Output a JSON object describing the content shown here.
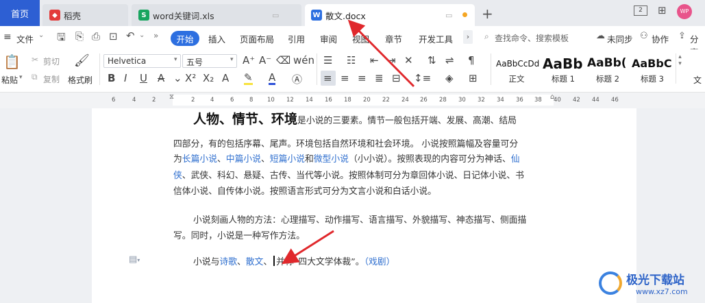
{
  "tabs": {
    "home": "首页",
    "daoke": "稻壳",
    "xls": "word关键词.xls",
    "docx": "散文.docx",
    "add": "+"
  },
  "window": {
    "avatar": "WP"
  },
  "menu": {
    "file": "文件",
    "start": "开始",
    "items": [
      "插入",
      "页面布局",
      "引用",
      "审阅",
      "视图",
      "章节",
      "开发工具"
    ],
    "search_placeholder": "查找命令、搜索模板",
    "unsync": "未同步",
    "collab": "协作",
    "share": "分享"
  },
  "toolbar": {
    "paste": "粘贴",
    "cut": "剪切",
    "copy": "复制",
    "format_painter": "格式刷",
    "font_name": "Helvetica",
    "font_size": "五号",
    "styles": [
      {
        "sample": "AaBbCcDd",
        "name": "正文"
      },
      {
        "sample": "AaBb",
        "name": "标题 1"
      },
      {
        "sample": "AaBb(",
        "name": "标题 2"
      },
      {
        "sample": "AaBbC",
        "name": "标题 3"
      }
    ],
    "more_label": "文"
  },
  "ruler": {
    "ticks": [
      "6",
      "4",
      "2",
      "2",
      "4",
      "6",
      "8",
      "10",
      "12",
      "14",
      "16",
      "18",
      "20",
      "22",
      "24",
      "26",
      "28",
      "30",
      "32",
      "34",
      "36",
      "38",
      "40",
      "42",
      "44",
      "46"
    ]
  },
  "document": {
    "p1_heading": "人物、情节、环境",
    "p1_line1_rest": "是小说的三要素。情节一般包括开端、发展、高潮、结局",
    "p1_line2": "四部分，有的包括序幕、尾声。环境包括自然环境和社会环境。 小说按照篇幅及容量可分",
    "p1_line3_a": "为",
    "p1_line3_link1": "长篇小说",
    "p1_line3_b": "、",
    "p1_line3_link2": "中篇小说",
    "p1_line3_c": "、",
    "p1_line3_link3": "短篇小说",
    "p1_line3_d": "和",
    "p1_line3_link4": "微型小说",
    "p1_line3_e": "（小小说）。按照表现的内容可分为神话、",
    "p1_line3_link5": "仙",
    "p1_line4_link": "侠",
    "p1_line4_rest": "、武侠、科幻、悬疑、古传、当代等小说。按照体制可分为章回体小说、日记体小说、书",
    "p1_line5": "信体小说、自传体小说。按照语言形式可分为文言小说和白话小说。",
    "p2_line1": "小说刻画人物的方法：心理描写、动作描写、语言描写、外貌描写、神态描写、侧面描",
    "p2_line2": "写。同时，小说是一种写作方法。",
    "p3_a": "小说与",
    "p3_link1": "诗歌",
    "p3_b": "、",
    "p3_link2": "散文",
    "p3_c": "、",
    "p3_d": "并称“四大文学体裁”。",
    "p3_link3": "（戏剧）"
  },
  "watermark": {
    "title": "极光下载站",
    "url": "www.xz7.com"
  }
}
